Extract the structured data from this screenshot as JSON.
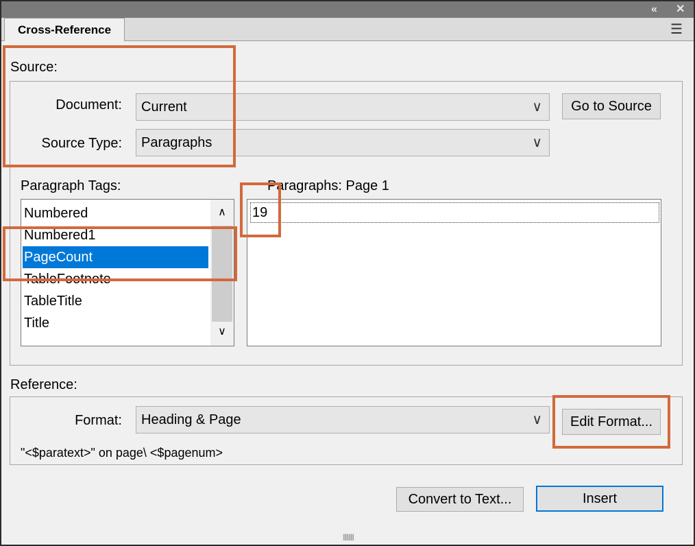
{
  "window": {
    "collapse_icon": "double-chevron-left-icon",
    "close_icon": "close-icon",
    "collapse_glyph": "«",
    "close_glyph": "✕"
  },
  "tab": {
    "label": "Cross-Reference",
    "menu_icon": "hamburger-menu-icon"
  },
  "source": {
    "section_label": "Source:",
    "document_label": "Document:",
    "document_value": "Current",
    "go_to_source_label": "Go to Source",
    "source_type_label": "Source Type:",
    "source_type_value": "Paragraphs",
    "paragraph_tags_label": "Paragraph Tags:",
    "paragraph_tags": [
      "Numbered",
      "Numbered1",
      "PageCount",
      "TableFootnote",
      "TableTitle",
      "Title"
    ],
    "selected_tag": "PageCount",
    "paragraphs_label": "Paragraphs: Page  1",
    "paragraphs": [
      "19"
    ]
  },
  "reference": {
    "section_label": "Reference:",
    "format_label": "Format:",
    "format_value": "Heading & Page",
    "edit_format_label": "Edit Format...",
    "format_definition": "\"<$paratext>\" on page\\ <$pagenum>"
  },
  "actions": {
    "convert_label": "Convert to Text...",
    "insert_label": "Insert"
  },
  "colors": {
    "highlight": "#d2693c",
    "selection": "#0078d7",
    "titlebar": "#7a7a7a"
  }
}
